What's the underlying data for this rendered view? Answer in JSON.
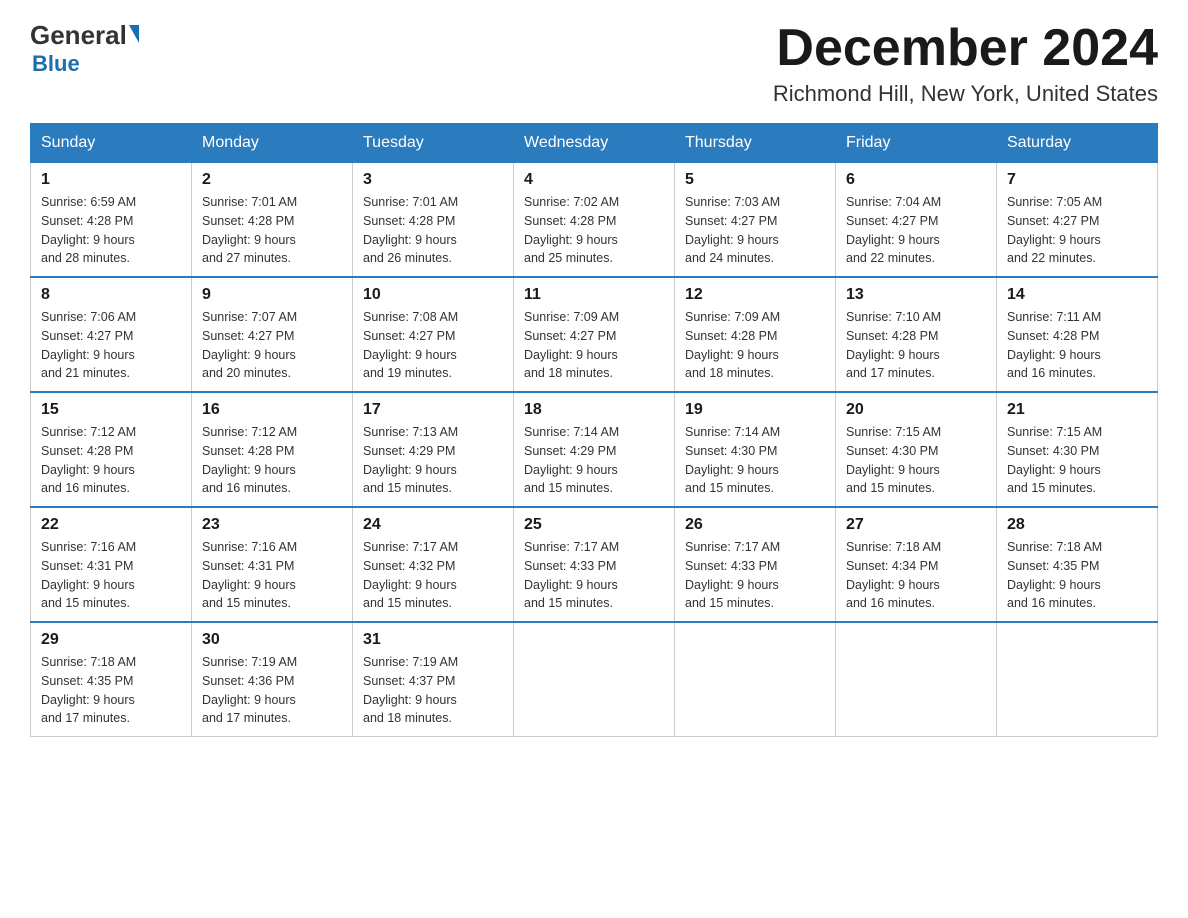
{
  "logo": {
    "general": "General",
    "triangle": "",
    "blue": "Blue"
  },
  "header": {
    "month_title": "December 2024",
    "location": "Richmond Hill, New York, United States"
  },
  "days_of_week": [
    "Sunday",
    "Monday",
    "Tuesday",
    "Wednesday",
    "Thursday",
    "Friday",
    "Saturday"
  ],
  "weeks": [
    [
      {
        "num": "1",
        "sunrise": "6:59 AM",
        "sunset": "4:28 PM",
        "daylight": "9 hours and 28 minutes."
      },
      {
        "num": "2",
        "sunrise": "7:01 AM",
        "sunset": "4:28 PM",
        "daylight": "9 hours and 27 minutes."
      },
      {
        "num": "3",
        "sunrise": "7:01 AM",
        "sunset": "4:28 PM",
        "daylight": "9 hours and 26 minutes."
      },
      {
        "num": "4",
        "sunrise": "7:02 AM",
        "sunset": "4:28 PM",
        "daylight": "9 hours and 25 minutes."
      },
      {
        "num": "5",
        "sunrise": "7:03 AM",
        "sunset": "4:27 PM",
        "daylight": "9 hours and 24 minutes."
      },
      {
        "num": "6",
        "sunrise": "7:04 AM",
        "sunset": "4:27 PM",
        "daylight": "9 hours and 22 minutes."
      },
      {
        "num": "7",
        "sunrise": "7:05 AM",
        "sunset": "4:27 PM",
        "daylight": "9 hours and 22 minutes."
      }
    ],
    [
      {
        "num": "8",
        "sunrise": "7:06 AM",
        "sunset": "4:27 PM",
        "daylight": "9 hours and 21 minutes."
      },
      {
        "num": "9",
        "sunrise": "7:07 AM",
        "sunset": "4:27 PM",
        "daylight": "9 hours and 20 minutes."
      },
      {
        "num": "10",
        "sunrise": "7:08 AM",
        "sunset": "4:27 PM",
        "daylight": "9 hours and 19 minutes."
      },
      {
        "num": "11",
        "sunrise": "7:09 AM",
        "sunset": "4:27 PM",
        "daylight": "9 hours and 18 minutes."
      },
      {
        "num": "12",
        "sunrise": "7:09 AM",
        "sunset": "4:28 PM",
        "daylight": "9 hours and 18 minutes."
      },
      {
        "num": "13",
        "sunrise": "7:10 AM",
        "sunset": "4:28 PM",
        "daylight": "9 hours and 17 minutes."
      },
      {
        "num": "14",
        "sunrise": "7:11 AM",
        "sunset": "4:28 PM",
        "daylight": "9 hours and 16 minutes."
      }
    ],
    [
      {
        "num": "15",
        "sunrise": "7:12 AM",
        "sunset": "4:28 PM",
        "daylight": "9 hours and 16 minutes."
      },
      {
        "num": "16",
        "sunrise": "7:12 AM",
        "sunset": "4:28 PM",
        "daylight": "9 hours and 16 minutes."
      },
      {
        "num": "17",
        "sunrise": "7:13 AM",
        "sunset": "4:29 PM",
        "daylight": "9 hours and 15 minutes."
      },
      {
        "num": "18",
        "sunrise": "7:14 AM",
        "sunset": "4:29 PM",
        "daylight": "9 hours and 15 minutes."
      },
      {
        "num": "19",
        "sunrise": "7:14 AM",
        "sunset": "4:30 PM",
        "daylight": "9 hours and 15 minutes."
      },
      {
        "num": "20",
        "sunrise": "7:15 AM",
        "sunset": "4:30 PM",
        "daylight": "9 hours and 15 minutes."
      },
      {
        "num": "21",
        "sunrise": "7:15 AM",
        "sunset": "4:30 PM",
        "daylight": "9 hours and 15 minutes."
      }
    ],
    [
      {
        "num": "22",
        "sunrise": "7:16 AM",
        "sunset": "4:31 PM",
        "daylight": "9 hours and 15 minutes."
      },
      {
        "num": "23",
        "sunrise": "7:16 AM",
        "sunset": "4:31 PM",
        "daylight": "9 hours and 15 minutes."
      },
      {
        "num": "24",
        "sunrise": "7:17 AM",
        "sunset": "4:32 PM",
        "daylight": "9 hours and 15 minutes."
      },
      {
        "num": "25",
        "sunrise": "7:17 AM",
        "sunset": "4:33 PM",
        "daylight": "9 hours and 15 minutes."
      },
      {
        "num": "26",
        "sunrise": "7:17 AM",
        "sunset": "4:33 PM",
        "daylight": "9 hours and 15 minutes."
      },
      {
        "num": "27",
        "sunrise": "7:18 AM",
        "sunset": "4:34 PM",
        "daylight": "9 hours and 16 minutes."
      },
      {
        "num": "28",
        "sunrise": "7:18 AM",
        "sunset": "4:35 PM",
        "daylight": "9 hours and 16 minutes."
      }
    ],
    [
      {
        "num": "29",
        "sunrise": "7:18 AM",
        "sunset": "4:35 PM",
        "daylight": "9 hours and 17 minutes."
      },
      {
        "num": "30",
        "sunrise": "7:19 AM",
        "sunset": "4:36 PM",
        "daylight": "9 hours and 17 minutes."
      },
      {
        "num": "31",
        "sunrise": "7:19 AM",
        "sunset": "4:37 PM",
        "daylight": "9 hours and 18 minutes."
      },
      null,
      null,
      null,
      null
    ]
  ],
  "labels": {
    "sunrise": "Sunrise:",
    "sunset": "Sunset:",
    "daylight": "Daylight:"
  }
}
